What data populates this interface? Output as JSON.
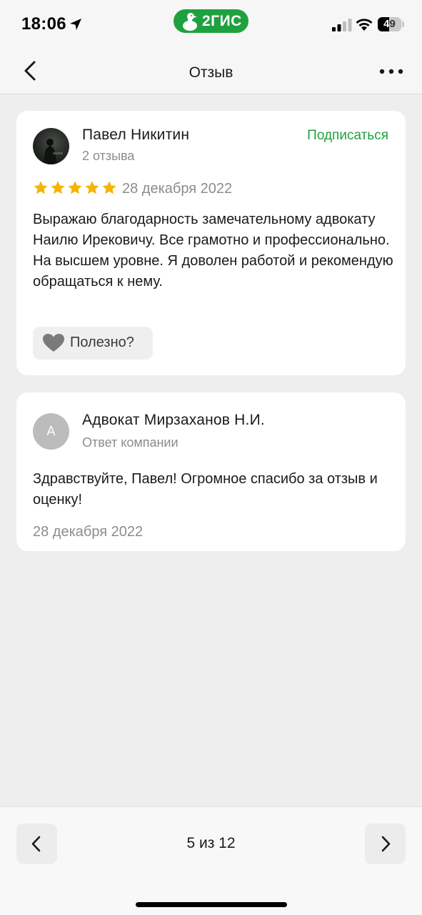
{
  "status_bar": {
    "time": "18:06",
    "brand": "2ГИС",
    "battery": "49"
  },
  "header": {
    "title": "Отзыв"
  },
  "review": {
    "author": "Павел Никитин",
    "author_reviews": "2 отзыва",
    "subscribe_label": "Подписаться",
    "rating": 5,
    "rating_max": 5,
    "date": "28 декабря 2022",
    "text": "Выражаю благодарность замечательному адвокату Наилю Ирековичу. Все грамотно и профессионально. На высшем уровне. Я доволен работой и рекомендую обращаться к нему.",
    "helpful_label": "Полезно?"
  },
  "reply": {
    "avatar_letter": "А",
    "company": "Адвокат Мирзаханов Н.И.",
    "subtitle": "Ответ компании",
    "text": "Здравствуйте, Павел! Огромное спасибо за отзыв и оценку!",
    "date": "28 декабря 2022"
  },
  "pager": {
    "counter": "5 из 12"
  },
  "colors": {
    "accent_green": "#1fa13f",
    "star_gold": "#f4b400",
    "background": "#eeeeee",
    "secondary_text": "#8c8c8c"
  },
  "icons": [
    "location-arrow-icon",
    "goose-mascot-icon",
    "cellular-signal-icon",
    "wifi-icon",
    "battery-icon",
    "chevron-left-icon",
    "more-dots-icon",
    "star-icon",
    "heart-icon",
    "chevron-right-icon"
  ]
}
